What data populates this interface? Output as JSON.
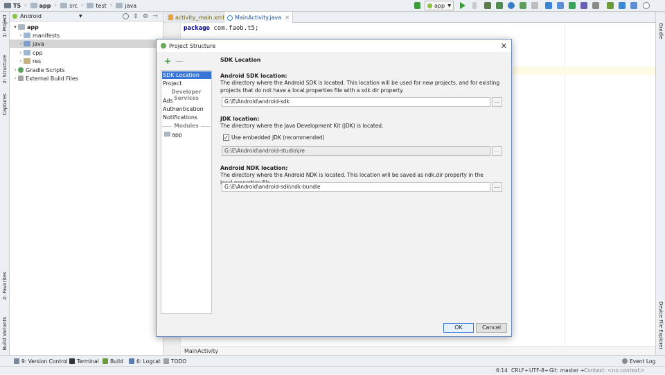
{
  "breadcrumbs": [
    "T5",
    "app",
    "src",
    "test",
    "java"
  ],
  "toolbar": {
    "run_config": "app"
  },
  "left_strip": {
    "project": "1: Project",
    "structure": "2: Structure",
    "captures": "Captures",
    "favorites": "2: Favorites",
    "build_variants": "Build Variants"
  },
  "right_strip": {
    "gradle": "Gradle",
    "device_file_explorer": "Device File Explorer"
  },
  "project_panel": {
    "view_mode": "Android",
    "tree": [
      {
        "label": "app",
        "bold": true
      },
      {
        "label": "manifests"
      },
      {
        "label": "java"
      },
      {
        "label": "cpp"
      },
      {
        "label": "res"
      },
      {
        "label": "Gradle Scripts"
      },
      {
        "label": "External Build Files"
      }
    ]
  },
  "editor": {
    "tabs": [
      "activity_main.xml",
      "MainActivity.java"
    ],
    "code_keyword": "package",
    "code_rest": " com.faob.t5;",
    "bottom_crumb": "MainActivity"
  },
  "dialog": {
    "title": "Project Structure",
    "close_glyph": "✕",
    "add_glyph": "+",
    "remove_glyph": "—",
    "nav": {
      "sdk_location": "SDK Location",
      "project": "Project",
      "developer_services": "Developer Services",
      "ads": "Ads",
      "authentication": "Authentication",
      "notifications": "Notifications",
      "modules": "Modules",
      "app": "app"
    },
    "content": {
      "heading": "SDK Location",
      "android_sdk_label": "Android SDK location:",
      "android_sdk_desc": "The directory where the Android SDK is located. This location will be used for new projects, and for existing projects that do not have a local.properties file with a sdk.dir property.",
      "android_sdk_path": "G:\\E\\Android\\android-sdk",
      "jdk_label": "JDK location:",
      "jdk_desc": "The directory where the Java Development Kit (JDK) is located.",
      "jdk_checkbox": "Use embedded JDK (recommended)",
      "jdk_path": "G:\\E\\Android\\android-studio\\jre",
      "ndk_label": "Android NDK location:",
      "ndk_desc": "The directory where the Android NDK is located. This location will be saved as ndk.dir property in the local.properties file.",
      "ndk_path": "G:\\E\\Android\\android-sdk\\ndk-bundle",
      "browse_glyph": "..."
    },
    "ok": "OK",
    "cancel": "Cancel"
  },
  "tool_windows": [
    "9: Version Control",
    "Terminal",
    "Build",
    "6: Logcat",
    "TODO",
    "Event Log"
  ],
  "status": {
    "position": "6:14",
    "line_sep": "CRLF÷",
    "encoding": "UTF-8÷",
    "git": "Git: master ÷",
    "context": "Context: <no context>"
  }
}
